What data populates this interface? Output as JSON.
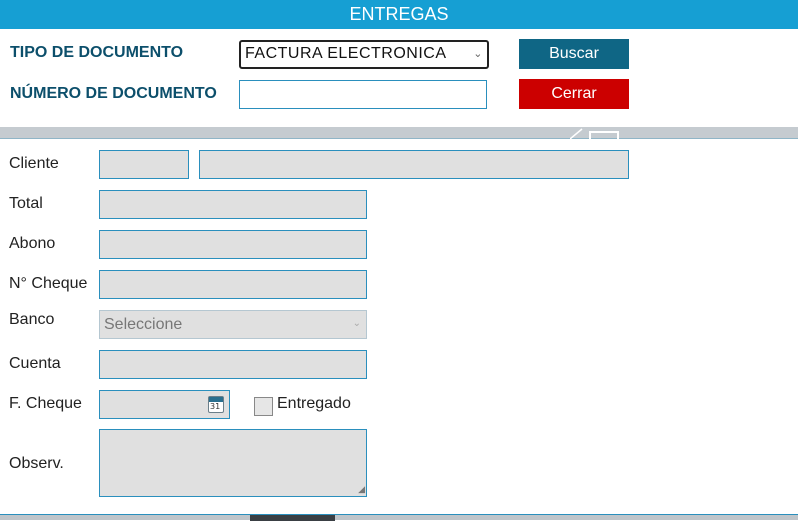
{
  "header": {
    "title": "ENTREGAS"
  },
  "search": {
    "doc_type_label": "TIPO DE DOCUMENTO",
    "doc_type_value": "FACTURA ELECTRONICA",
    "doc_number_label": "NÚMERO DE DOCUMENTO",
    "doc_number_value": "",
    "buscar_label": "Buscar",
    "cerrar_label": "Cerrar"
  },
  "form": {
    "cliente_label": "Cliente",
    "total_label": "Total",
    "abono_label": "Abono",
    "cheque_label": "N° Cheque",
    "banco_label": "Banco",
    "banco_value": "Seleccione",
    "cuenta_label": "Cuenta",
    "fcheque_label": "F. Cheque",
    "calendar_day": "31",
    "entregado_label": "Entregado",
    "observ_label": "Observ."
  },
  "colors": {
    "header_bg": "#169fd3",
    "label_text": "#0c4f6b",
    "buscar_bg": "#0f6685",
    "cerrar_bg": "#cc0000",
    "field_bg": "#e0e0e0",
    "field_border": "#2a8fbd"
  },
  "icons": {
    "calendar": "calendar-icon",
    "dropdown": "chevron-down-icon",
    "resize": "resize-grip-icon"
  }
}
